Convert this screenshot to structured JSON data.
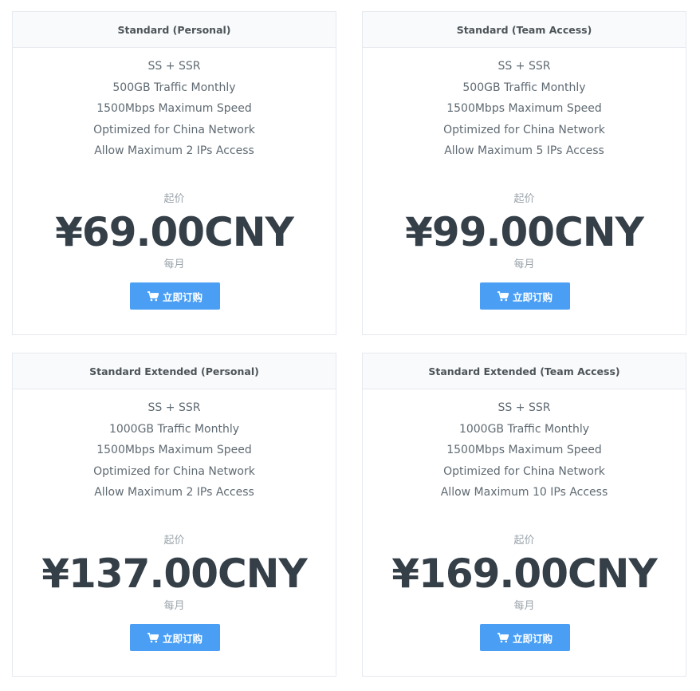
{
  "buy_label": "立即订购",
  "accent_color": "#4a9ff5",
  "plans": [
    {
      "title": "Standard (Personal)",
      "features": [
        "SS + SSR",
        "500GB Traffic Monthly",
        "1500Mbps Maximum Speed",
        "Optimized for China Network",
        "Allow Maximum 2 IPs Access"
      ],
      "price_prefix": "起价",
      "price": "¥69.00CNY",
      "price_suffix": "每月"
    },
    {
      "title": "Standard (Team Access)",
      "features": [
        "SS + SSR",
        "500GB Traffic Monthly",
        "1500Mbps Maximum Speed",
        "Optimized for China Network",
        "Allow Maximum 5 IPs Access"
      ],
      "price_prefix": "起价",
      "price": "¥99.00CNY",
      "price_suffix": "每月"
    },
    {
      "title": "Standard Extended (Personal)",
      "features": [
        "SS + SSR",
        "1000GB Traffic Monthly",
        "1500Mbps Maximum Speed",
        "Optimized for China Network",
        "Allow Maximum 2 IPs Access"
      ],
      "price_prefix": "起价",
      "price": "¥137.00CNY",
      "price_suffix": "每月"
    },
    {
      "title": "Standard Extended (Team Access)",
      "features": [
        "SS + SSR",
        "1000GB Traffic Monthly",
        "1500Mbps Maximum Speed",
        "Optimized for China Network",
        "Allow Maximum 10 IPs Access"
      ],
      "price_prefix": "起价",
      "price": "¥169.00CNY",
      "price_suffix": "每月"
    }
  ]
}
